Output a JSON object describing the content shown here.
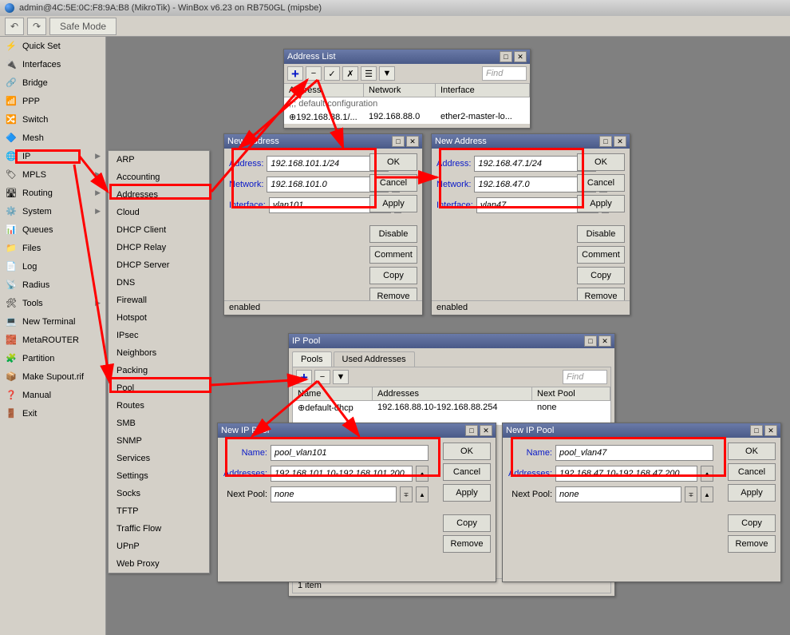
{
  "titlebar": "admin@4C:5E:0C:F8:9A:B8 (MikroTik) - WinBox v6.23 on RB750GL (mipsbe)",
  "toolbar": {
    "safemode": "Safe Mode"
  },
  "sidebar": [
    {
      "icon": "⚡",
      "label": "Quick Set"
    },
    {
      "icon": "🔌",
      "label": "Interfaces"
    },
    {
      "icon": "🔗",
      "label": "Bridge"
    },
    {
      "icon": "📶",
      "label": "PPP"
    },
    {
      "icon": "🔀",
      "label": "Switch"
    },
    {
      "icon": "🔷",
      "label": "Mesh"
    },
    {
      "icon": "🌐",
      "label": "IP",
      "sub": true
    },
    {
      "icon": "🏷",
      "label": "MPLS",
      "sub": true
    },
    {
      "icon": "🛣",
      "label": "Routing",
      "sub": true
    },
    {
      "icon": "⚙️",
      "label": "System",
      "sub": true
    },
    {
      "icon": "📊",
      "label": "Queues"
    },
    {
      "icon": "📁",
      "label": "Files"
    },
    {
      "icon": "📄",
      "label": "Log"
    },
    {
      "icon": "📡",
      "label": "Radius"
    },
    {
      "icon": "🛠",
      "label": "Tools",
      "sub": true
    },
    {
      "icon": "💻",
      "label": "New Terminal"
    },
    {
      "icon": "🧱",
      "label": "MetaROUTER"
    },
    {
      "icon": "🧩",
      "label": "Partition"
    },
    {
      "icon": "📦",
      "label": "Make Supout.rif"
    },
    {
      "icon": "❓",
      "label": "Manual"
    },
    {
      "icon": "🚪",
      "label": "Exit"
    }
  ],
  "submenu": [
    "ARP",
    "Accounting",
    "Addresses",
    "Cloud",
    "DHCP Client",
    "DHCP Relay",
    "DHCP Server",
    "DNS",
    "Firewall",
    "Hotspot",
    "IPsec",
    "Neighbors",
    "Packing",
    "Pool",
    "Routes",
    "SMB",
    "SNMP",
    "Services",
    "Settings",
    "Socks",
    "TFTP",
    "Traffic Flow",
    "UPnP",
    "Web Proxy"
  ],
  "addrlist": {
    "title": "Address List",
    "cols": [
      "Address",
      "Network",
      "Interface"
    ],
    "group": ";;; default configuration",
    "row": {
      "addr": "⊕192.168.88.1/...",
      "net": "192.168.88.0",
      "iface": "ether2-master-lo..."
    },
    "find": "Find"
  },
  "newaddr1": {
    "title": "New Address",
    "labels": {
      "addr": "Address:",
      "net": "Network:",
      "iface": "Interface:"
    },
    "values": {
      "addr": "192.168.101.1/24",
      "net": "192.168.101.0",
      "iface": "vlan101"
    },
    "status": "enabled"
  },
  "newaddr2": {
    "title": "New Address",
    "labels": {
      "addr": "Address:",
      "net": "Network:",
      "iface": "Interface:"
    },
    "values": {
      "addr": "192.168.47.1/24",
      "net": "192.168.47.0",
      "iface": "vlan47"
    },
    "status": "enabled"
  },
  "buttons": {
    "ok": "OK",
    "cancel": "Cancel",
    "apply": "Apply",
    "disable": "Disable",
    "comment": "Comment",
    "copy": "Copy",
    "remove": "Remove"
  },
  "ippool": {
    "title": "IP Pool",
    "tabs": [
      "Pools",
      "Used Addresses"
    ],
    "cols": [
      "Name",
      "Addresses",
      "Next Pool"
    ],
    "row": {
      "name": "⊕default-dhcp",
      "addr": "192.168.88.10-192.168.88.254",
      "next": "none"
    },
    "find": "Find",
    "status": "1 item"
  },
  "newpool1": {
    "title": "New IP Pool",
    "labels": {
      "name": "Name:",
      "addr": "Addresses:",
      "next": "Next Pool:"
    },
    "values": {
      "name": "pool_vlan101",
      "addr": "192.168.101.10-192.168.101.200",
      "next": "none"
    }
  },
  "newpool2": {
    "title": "New IP Pool",
    "labels": {
      "name": "Name:",
      "addr": "Addresses:",
      "next": "Next Pool:"
    },
    "values": {
      "name": "pool_vlan47",
      "addr": "192.168.47.10-192.168.47.200",
      "next": "none"
    }
  }
}
